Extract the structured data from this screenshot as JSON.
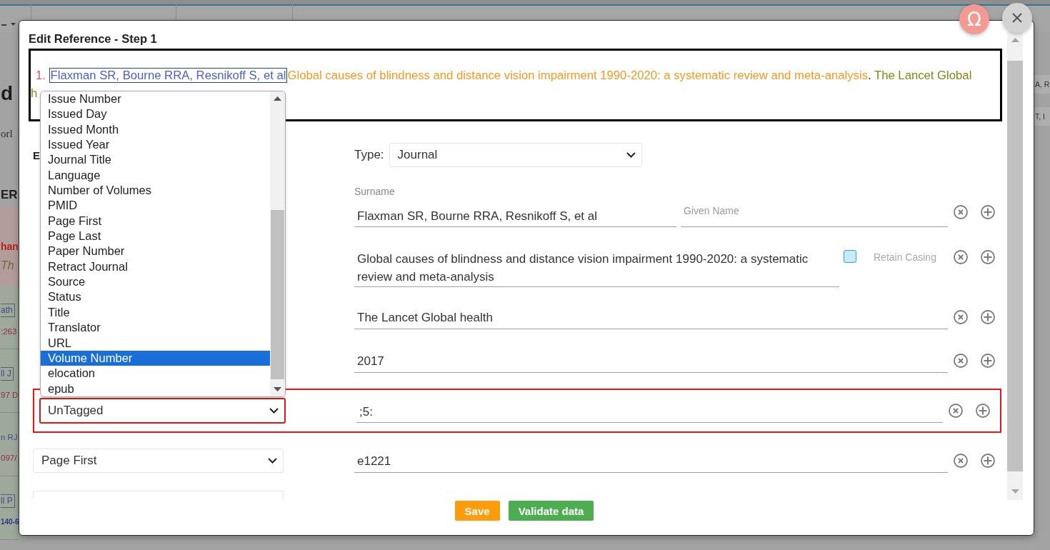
{
  "background": {
    "left_sections": [
      {
        "kind": "header",
        "fragments": [
          {
            "kind": "title",
            "text": "d"
          },
          {
            "kind": "serif",
            "text": "orl"
          },
          {
            "kind": "heading",
            "text": "ER"
          }
        ]
      },
      {
        "kind": "alert",
        "fragments": [
          {
            "kind": "alert",
            "text": "han"
          },
          {
            "kind": "italic",
            "text": "Th"
          }
        ]
      },
      {
        "kind": "entry",
        "fragments": [
          {
            "kind": "boxed",
            "text": "ath"
          },
          {
            "kind": "code",
            "text": ":263"
          }
        ]
      },
      {
        "kind": "entry",
        "fragments": [
          {
            "kind": "boxed",
            "text": "ll J"
          },
          {
            "kind": "code",
            "text": "97 D"
          }
        ]
      },
      {
        "kind": "entry",
        "fragments": [
          {
            "kind": "author",
            "text": "n RJ"
          },
          {
            "kind": "code",
            "text": "097/"
          }
        ]
      },
      {
        "kind": "entry",
        "fragments": [
          {
            "kind": "boxed",
            "text": "ll P"
          },
          {
            "kind": "small",
            "text": "140-6"
          }
        ]
      }
    ],
    "right_fragments": [
      "A, R",
      "T, I"
    ]
  },
  "special_character_button": {
    "label": "Ω"
  },
  "modal": {
    "title": "Edit Reference - Step 1",
    "reference": {
      "line_1": [
        {
          "text": "1. ",
          "color": "#e0566e",
          "outlined": false
        },
        {
          "text": "Flaxman SR, Bourne RRA, Resnikoff S, et al",
          "color": "#4b5fc5",
          "outlined": true
        },
        {
          "text": "Global causes of blindness and distance vision impairment 1990-2020: a systematic review and meta-analysis",
          "color": "#f7981d",
          "outlined": false
        },
        {
          "text": ". ",
          "outlined": false
        },
        {
          "text": "The Lancet Global",
          "color": "#868614",
          "outlined": false
        }
      ],
      "line_2": [
        {
          "text": "h",
          "color": "#868614",
          "outlined": false
        }
      ]
    },
    "type_row": {
      "left_label": "E",
      "label": "Type:",
      "value": "Journal"
    },
    "rows": [
      {
        "kind": "name",
        "surname_label": "Surname",
        "surname": "Flaxman SR, Bourne RRA, Resnikoff S, et al",
        "given_name_placeholder": "Given Name"
      },
      {
        "kind": "title",
        "value": "Global causes of blindness and distance vision impairment 1990-2020: a systematic review and meta-analysis",
        "retain_casing": {
          "label": "Retain Casing",
          "checked": false
        }
      },
      {
        "kind": "text",
        "value": "The Lancet Global health"
      },
      {
        "kind": "text",
        "value": "2017"
      },
      {
        "kind": "text",
        "tag": "UnTagged",
        "untagged": true,
        "value": ";5:"
      },
      {
        "kind": "text",
        "tag": "Page First",
        "untagged": false,
        "value": "e1221"
      },
      {
        "kind": "cut"
      }
    ],
    "tag_dropdown": {
      "options": [
        {
          "label": "Issue Number",
          "selected": false
        },
        {
          "label": "Issued Day",
          "selected": false
        },
        {
          "label": "Issued Month",
          "selected": false
        },
        {
          "label": "Issued Year",
          "selected": false
        },
        {
          "label": "Journal Title",
          "selected": false
        },
        {
          "label": "Language",
          "selected": false
        },
        {
          "label": "Number of Volumes",
          "selected": false
        },
        {
          "label": "PMID",
          "selected": false
        },
        {
          "label": "Page First",
          "selected": false
        },
        {
          "label": "Page Last",
          "selected": false
        },
        {
          "label": "Paper Number",
          "selected": false
        },
        {
          "label": "Retract Journal",
          "selected": false
        },
        {
          "label": "Source",
          "selected": false
        },
        {
          "label": "Status",
          "selected": false
        },
        {
          "label": "Title",
          "selected": false
        },
        {
          "label": "Translator",
          "selected": false
        },
        {
          "label": "URL",
          "selected": false
        },
        {
          "label": "Volume Number",
          "selected": true
        },
        {
          "label": "elocation",
          "selected": false
        },
        {
          "label": "epub",
          "selected": false
        }
      ]
    },
    "buttons": [
      {
        "kind": "save",
        "label": "Save"
      },
      {
        "kind": "validate",
        "label": "Validate data"
      }
    ]
  }
}
